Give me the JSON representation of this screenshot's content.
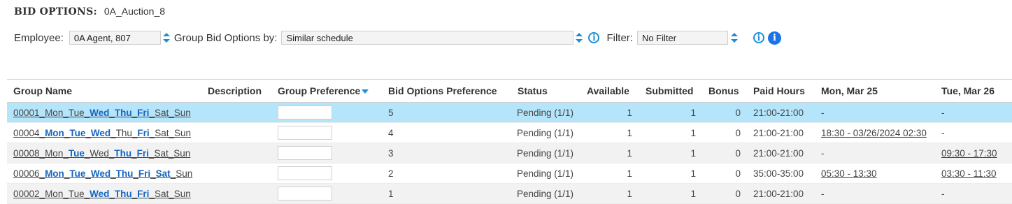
{
  "header": {
    "label": "BID OPTIONS:",
    "auction": "0A_Auction_8"
  },
  "filters": {
    "employee_label": "Employee:",
    "employee_value": "0A Agent, 807",
    "group_by_label": "Group Bid Options by:",
    "group_by_value": "Similar schedule",
    "filter_label": "Filter:",
    "filter_value": "No Filter"
  },
  "table": {
    "columns": [
      "Group Name",
      "Description",
      "Group Preference",
      "Bid Options Preference",
      "Status",
      "Available",
      "Submitted",
      "Bonus",
      "Paid Hours",
      "Mon, Mar 25",
      "Tue, Mar 26"
    ],
    "rows": [
      {
        "id": "00001",
        "days": [
          "Mon",
          "Tue",
          "Wed",
          "Thu",
          "Fri",
          "Sat",
          "Sun"
        ],
        "pref": "5",
        "status": "Pending (1/1)",
        "available": "1",
        "submitted": "1",
        "bonus": "0",
        "paid": "21:00-21:00",
        "mon": "-",
        "tue": "-"
      },
      {
        "id": "00004",
        "days": [
          "Mon",
          "Tue",
          "Wed",
          "Thu",
          "Fri",
          "Sat",
          "Sun"
        ],
        "pref": "4",
        "status": "Pending (1/1)",
        "available": "1",
        "submitted": "1",
        "bonus": "0",
        "paid": "21:00-21:00",
        "mon": "18:30 - 03/26/2024 02:30",
        "tue": "-"
      },
      {
        "id": "00008",
        "days": [
          "Mon",
          "Tue",
          "Wed",
          "Thu",
          "Fri",
          "Sat",
          "Sun"
        ],
        "pref": "3",
        "status": "Pending (1/1)",
        "available": "1",
        "submitted": "1",
        "bonus": "0",
        "paid": "21:00-21:00",
        "mon": "-",
        "tue": "09:30 - 17:30"
      },
      {
        "id": "00006",
        "days": [
          "Mon",
          "Tue",
          "Wed",
          "Thu",
          "Fri",
          "Sat",
          "Sun"
        ],
        "pref": "2",
        "status": "Pending (1/1)",
        "available": "1",
        "submitted": "1",
        "bonus": "0",
        "paid": "35:00-35:00",
        "mon": "05:30 - 13:30",
        "tue": "03:30 - 11:30"
      },
      {
        "id": "00002",
        "days": [
          "Mon",
          "Tue",
          "Wed",
          "Thu",
          "Fri",
          "Sat",
          "Sun"
        ],
        "pref": "1",
        "status": "Pending (1/1)",
        "available": "1",
        "submitted": "1",
        "bonus": "0",
        "paid": "21:00-21:00",
        "mon": "-",
        "tue": "-"
      }
    ]
  },
  "colors": {
    "accent": "#1a8fd8",
    "link_bold": "#1565c0",
    "selected_row": "#b5e5fb",
    "alt_row": "#f2f2f2"
  }
}
